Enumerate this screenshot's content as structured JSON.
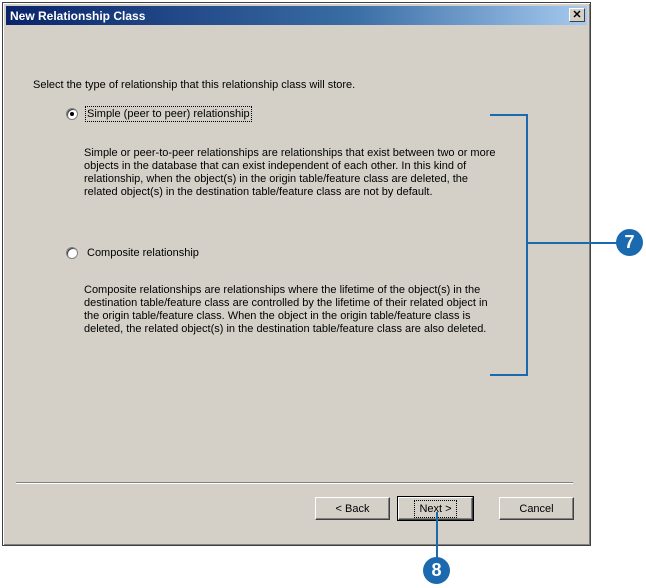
{
  "window": {
    "title": "New Relationship Class",
    "close_glyph": "✕"
  },
  "prompt": "Select the type of relationship that this relationship class will store.",
  "options": [
    {
      "label": "Simple (peer to peer) relationship",
      "selected": true,
      "description": "Simple or peer-to-peer relationships are relationships that exist between two or more objects in the database that can exist independent of each other. In this kind of relationship, when the object(s) in the origin table/feature class are deleted, the related object(s) in the destination table/feature class are not by default."
    },
    {
      "label": "Composite relationship",
      "selected": false,
      "description": "Composite relationships are relationships where the lifetime of the object(s) in the destination table/feature class are controlled by the lifetime of their related object in the origin table/feature class. When the object in the origin table/feature class is deleted, the related object(s) in the destination table/feature class are also deleted."
    }
  ],
  "buttons": {
    "back": "< Back",
    "next": "Next >",
    "cancel": "Cancel"
  },
  "callouts": {
    "step7": "7",
    "step8": "8"
  },
  "colors": {
    "accent": "#1b6ab0",
    "dialog_bg": "#d4d0c8",
    "title_bar": "#0a246a"
  }
}
